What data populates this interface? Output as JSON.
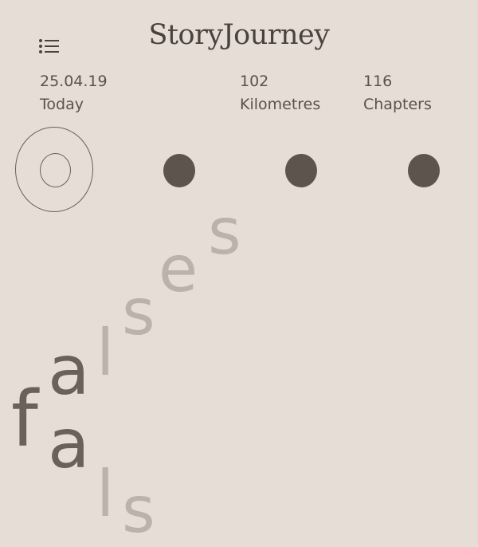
{
  "header": {
    "app_title": "StoryJourney",
    "menu_icon": "list-icon"
  },
  "stats": {
    "date_value": "25.04.19",
    "date_label": "Today",
    "distance_value": "102",
    "distance_label": "Kilometres",
    "chapters_value": "116",
    "chapters_label": "Chapters"
  },
  "timeline": {
    "dots": [
      "dot-1",
      "dot-2",
      "dot-3",
      "dot-4"
    ],
    "active_index": 0
  },
  "word_art": {
    "letters": [
      "f",
      "a",
      "l",
      "s",
      "e",
      "s",
      "a",
      "l",
      "s"
    ]
  },
  "colors": {
    "background": "#e6ddd6",
    "dot": "#5e544e",
    "text_dark": "#4a423d",
    "letter_light": "#bbb2ab"
  }
}
